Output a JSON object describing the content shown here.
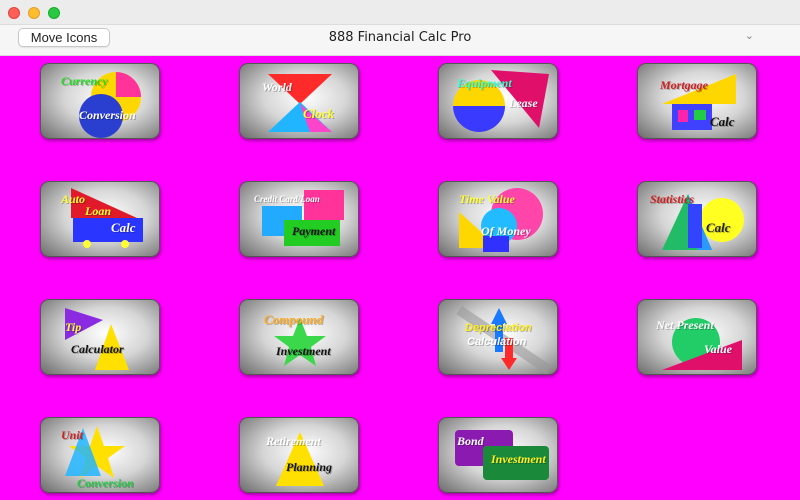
{
  "window": {
    "title": "888 Financial Calc Pro"
  },
  "toolbar": {
    "move_icons_label": "Move Icons"
  },
  "tiles": [
    {
      "line1": "Currency",
      "line2": "Conversion"
    },
    {
      "line1": "World",
      "line2": "Clock"
    },
    {
      "line1": "Equipment",
      "line2": "Lease"
    },
    {
      "line1": "Mortgage",
      "line2": "Calc"
    },
    {
      "line1": "Auto",
      "line2": "Loan",
      "line3": "Calc"
    },
    {
      "line1": "Credit Card/Loan",
      "line2": "Payment"
    },
    {
      "line1": "Time Value",
      "line2": "Of Money"
    },
    {
      "line1": "Statistics",
      "line2": "Calc"
    },
    {
      "line1": "Tip",
      "line2": "Calculator"
    },
    {
      "line1": "Compound",
      "line2": "Investment"
    },
    {
      "line1": "Depreciation",
      "line2": "Calculation"
    },
    {
      "line1": "Net Present",
      "line2": "Value"
    },
    {
      "line1": "Unit",
      "line2": "Conversion"
    },
    {
      "line1": "Retirement",
      "line2": "Planning"
    },
    {
      "line1": "Bond",
      "line2": "Investment"
    }
  ],
  "colors": {
    "background": "#ff00ff"
  }
}
